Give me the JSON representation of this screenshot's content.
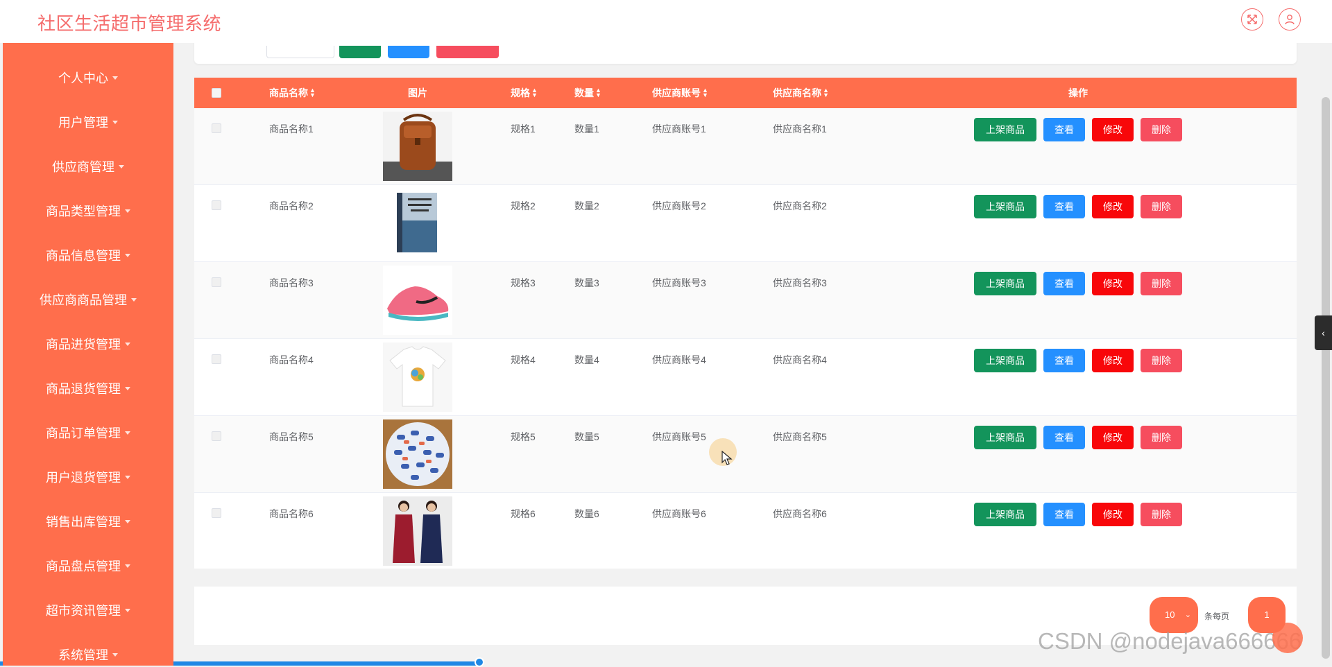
{
  "app": {
    "title": "社区生活超市管理系统"
  },
  "colors": {
    "accent": "#ff6e4c",
    "title": "#f56c6c",
    "up": "#13945b",
    "view": "#2490ff",
    "edit": "#f8070a",
    "delete": "#f64d5e"
  },
  "header": {
    "icons": [
      "fullscreen-icon",
      "user-icon"
    ]
  },
  "sidebar": {
    "items": [
      {
        "label": "个人中心"
      },
      {
        "label": "用户管理"
      },
      {
        "label": "供应商管理"
      },
      {
        "label": "商品类型管理"
      },
      {
        "label": "商品信息管理"
      },
      {
        "label": "供应商商品管理"
      },
      {
        "label": "商品进货管理"
      },
      {
        "label": "商品退货管理"
      },
      {
        "label": "商品订单管理"
      },
      {
        "label": "用户退货管理"
      },
      {
        "label": "销售出库管理"
      },
      {
        "label": "商品盘点管理"
      },
      {
        "label": "超市资讯管理"
      },
      {
        "label": "系统管理"
      }
    ]
  },
  "table": {
    "headers": {
      "name": "商品名称",
      "image": "图片",
      "spec": "规格",
      "quantity": "数量",
      "supplier_account": "供应商账号",
      "supplier_name": "供应商名称",
      "actions": "操作"
    },
    "actions": {
      "up": "上架商品",
      "view": "查看",
      "edit": "修改",
      "delete": "删除"
    },
    "rows": [
      {
        "name": "商品名称1",
        "image": "leather-bag",
        "spec": "规格1",
        "quantity": "数量1",
        "supplier_account": "供应商账号1",
        "supplier_name": "供应商名称1"
      },
      {
        "name": "商品名称2",
        "image": "book",
        "spec": "规格2",
        "quantity": "数量2",
        "supplier_account": "供应商账号2",
        "supplier_name": "供应商名称2"
      },
      {
        "name": "商品名称3",
        "image": "pink-sneaker",
        "spec": "规格3",
        "quantity": "数量3",
        "supplier_account": "供应商账号3",
        "supplier_name": "供应商名称3"
      },
      {
        "name": "商品名称4",
        "image": "white-tshirt",
        "spec": "规格4",
        "quantity": "数量4",
        "supplier_account": "供应商账号4",
        "supplier_name": "供应商名称4"
      },
      {
        "name": "商品名称5",
        "image": "candies",
        "spec": "规格5",
        "quantity": "数量5",
        "supplier_account": "供应商账号5",
        "supplier_name": "供应商名称5"
      },
      {
        "name": "商品名称6",
        "image": "dresses",
        "spec": "规格6",
        "quantity": "数量6",
        "supplier_account": "供应商账号6",
        "supplier_name": "供应商名称6"
      }
    ]
  },
  "pagination": {
    "page_size": "10",
    "per_page_label": "条每页",
    "current_page": "1"
  },
  "watermark": "CSDN @nodejava666666"
}
